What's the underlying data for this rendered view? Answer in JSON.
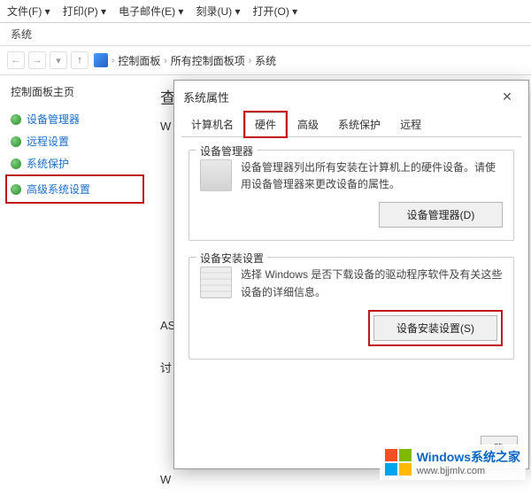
{
  "menubar": {
    "file": "文件(F)",
    "print": "打印(P)",
    "email": "电子邮件(E)",
    "burn": "刻录(U)",
    "open": "打开(O)"
  },
  "title_strip": "系统",
  "breadcrumb": {
    "items": [
      "控制面板",
      "所有控制面板项",
      "系统"
    ]
  },
  "sidepanel": {
    "title": "控制面板主页",
    "items": [
      {
        "label": "设备管理器"
      },
      {
        "label": "远程设置"
      },
      {
        "label": "系统保护"
      },
      {
        "label": "高级系统设置",
        "highlight": true
      }
    ]
  },
  "right_cutoff": {
    "line1": "查",
    "line2": "W",
    "line3": "AS",
    "line4": "讨",
    "line5": "W"
  },
  "dialog": {
    "title": "系统属性",
    "tabs": {
      "t0": "计算机名",
      "t1": "硬件",
      "t2": "高级",
      "t3": "系统保护",
      "t4": "远程"
    },
    "group1": {
      "title": "设备管理器",
      "desc": "设备管理器列出所有安装在计算机上的硬件设备。请使用设备管理器来更改设备的属性。",
      "button": "设备管理器(D)"
    },
    "group2": {
      "title": "设备安装设置",
      "desc": "选择 Windows 是否下载设备的驱动程序软件及有关这些设备的详细信息。",
      "button": "设备安装设置(S)"
    },
    "ok": "确"
  },
  "watermark": {
    "line1": "Windows系统之家",
    "line2": "www.bjjmlv.com"
  }
}
